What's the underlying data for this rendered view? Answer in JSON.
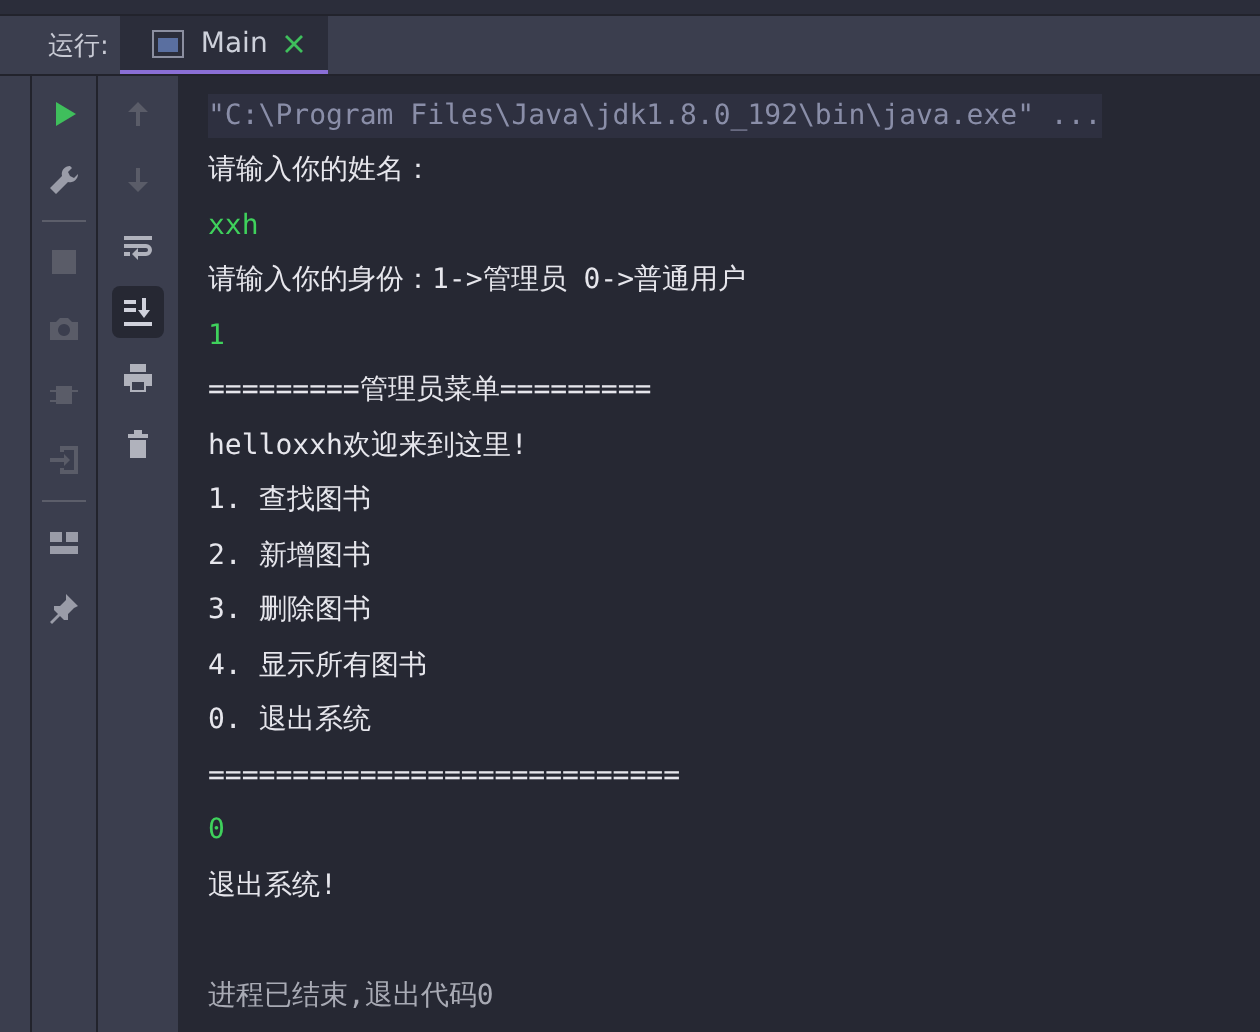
{
  "run_panel": {
    "label": "运行:",
    "tabs": [
      {
        "label": "Main",
        "selected": true
      }
    ]
  },
  "left_toolbar": [
    {
      "kind": "run",
      "disabled": false
    },
    {
      "kind": "wrench",
      "disabled": false
    },
    {
      "kind": "sep"
    },
    {
      "kind": "stop",
      "disabled": true
    },
    {
      "kind": "camera",
      "disabled": true
    },
    {
      "kind": "bug",
      "disabled": true
    },
    {
      "kind": "login",
      "disabled": true
    },
    {
      "kind": "sep"
    },
    {
      "kind": "layout",
      "disabled": false
    },
    {
      "kind": "pin",
      "disabled": false
    }
  ],
  "console_toolbar": [
    {
      "kind": "up",
      "disabled": true,
      "selected": false
    },
    {
      "kind": "down",
      "disabled": true,
      "selected": false
    },
    {
      "kind": "wrap",
      "disabled": false,
      "selected": false
    },
    {
      "kind": "scroll-end",
      "disabled": false,
      "selected": true
    },
    {
      "kind": "print",
      "disabled": false,
      "selected": false
    },
    {
      "kind": "trash",
      "disabled": false,
      "selected": false
    }
  ],
  "console_lines": [
    {
      "kind": "command",
      "text": "\"C:\\Program Files\\Java\\jdk1.8.0_192\\bin\\java.exe\" ..."
    },
    {
      "kind": "output",
      "text": "请输入你的姓名："
    },
    {
      "kind": "input",
      "text": "xxh"
    },
    {
      "kind": "output",
      "text": "请输入你的身份：1->管理员 0->普通用户"
    },
    {
      "kind": "input",
      "text": "1"
    },
    {
      "kind": "output",
      "text": "=========管理员菜单========="
    },
    {
      "kind": "output",
      "text": "helloxxh欢迎来到这里!"
    },
    {
      "kind": "output",
      "text": "1. 查找图书"
    },
    {
      "kind": "output",
      "text": "2. 新增图书"
    },
    {
      "kind": "output",
      "text": "3. 删除图书"
    },
    {
      "kind": "output",
      "text": "4. 显示所有图书"
    },
    {
      "kind": "output",
      "text": "0. 退出系统"
    },
    {
      "kind": "output",
      "text": "============================"
    },
    {
      "kind": "input",
      "text": "0"
    },
    {
      "kind": "output",
      "text": "退出系统!"
    },
    {
      "kind": "blank"
    },
    {
      "kind": "exit",
      "text": "进程已结束,退出代码0"
    }
  ]
}
